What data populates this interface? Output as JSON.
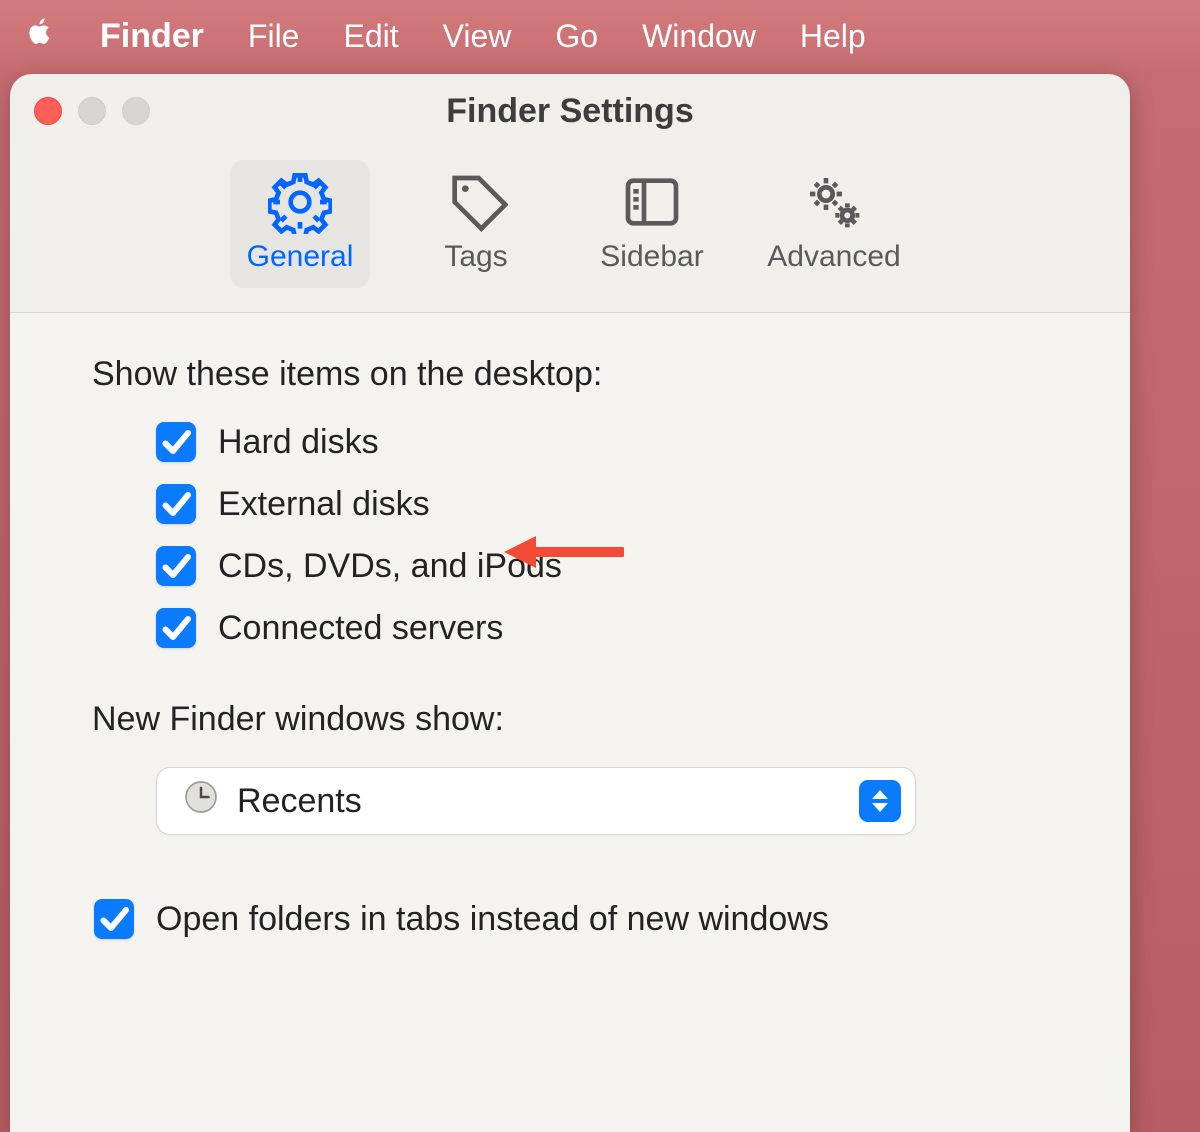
{
  "menubar": {
    "items": [
      "Finder",
      "File",
      "Edit",
      "View",
      "Go",
      "Window",
      "Help"
    ]
  },
  "window": {
    "title": "Finder Settings",
    "tabs": [
      {
        "label": "General",
        "icon": "gear-icon",
        "selected": true
      },
      {
        "label": "Tags",
        "icon": "tag-icon",
        "selected": false
      },
      {
        "label": "Sidebar",
        "icon": "sidebar-icon",
        "selected": false
      },
      {
        "label": "Advanced",
        "icon": "gears-icon",
        "selected": false
      }
    ]
  },
  "content": {
    "section1_heading": "Show these items on the desktop:",
    "desktop_items": [
      {
        "label": "Hard disks",
        "checked": true
      },
      {
        "label": "External disks",
        "checked": true
      },
      {
        "label": "CDs, DVDs, and iPods",
        "checked": true
      },
      {
        "label": "Connected servers",
        "checked": true
      }
    ],
    "section2_heading": "New Finder windows show:",
    "new_window_value": "Recents",
    "open_in_tabs": {
      "label": "Open folders in tabs instead of new windows",
      "checked": true
    }
  },
  "colors": {
    "accent": "#0a7bff",
    "arrow": "#f34b36"
  }
}
